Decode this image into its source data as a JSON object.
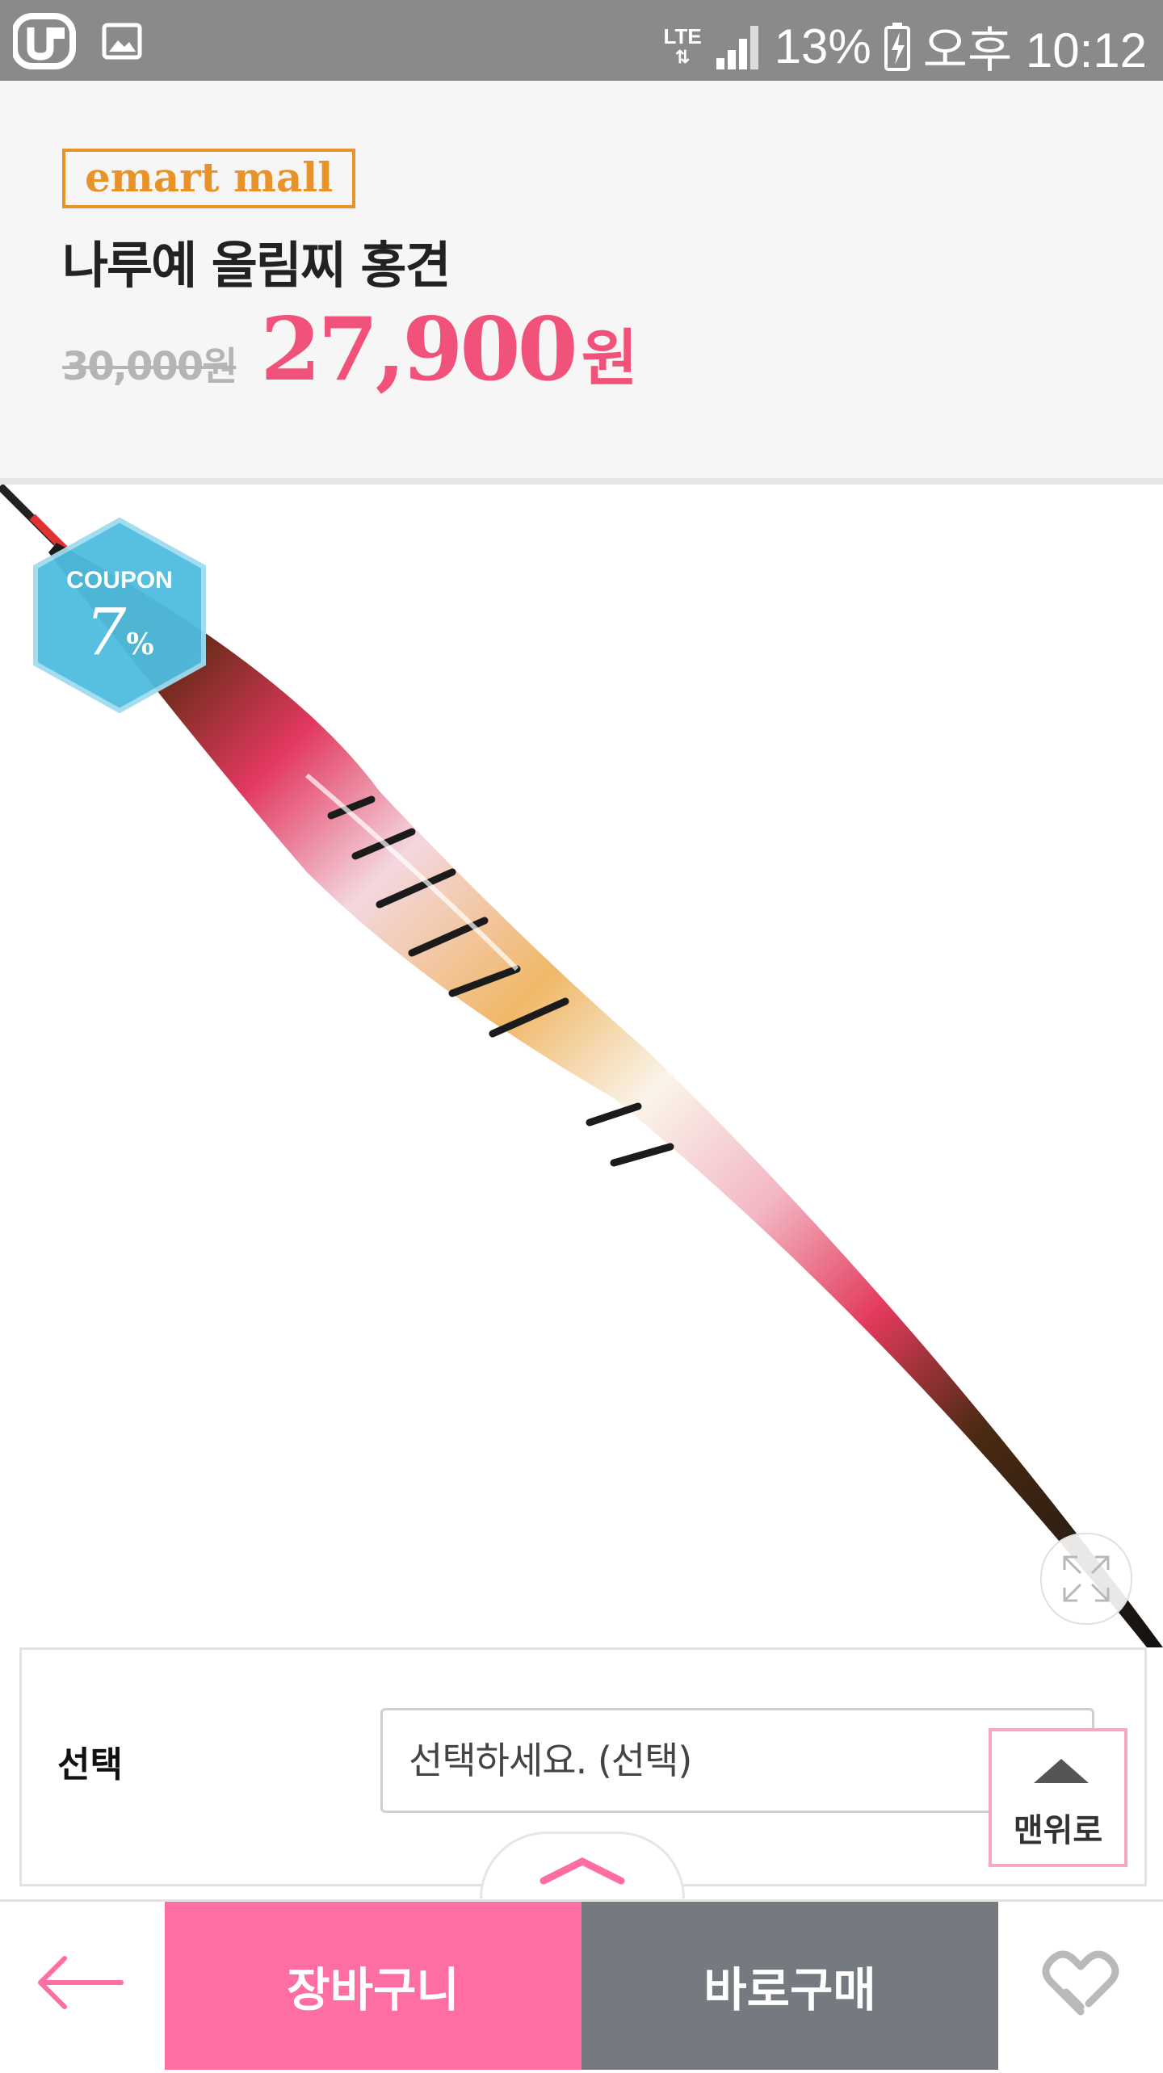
{
  "status_bar": {
    "network": "LTE",
    "battery": "13%",
    "time": "오후 10:12"
  },
  "product": {
    "store": "emart mall",
    "name": "나루예 올림찌 홍견",
    "original_price": "30,000원",
    "sale_price_number": "27,900",
    "sale_price_unit": "원"
  },
  "coupon": {
    "label": "COUPON",
    "value": "7",
    "unit": "%"
  },
  "options": {
    "label": "선택",
    "select_value": "선택하세요. (선택)"
  },
  "scroll_top": {
    "label": "맨위로"
  },
  "bottom_bar": {
    "cart_label": "장바구니",
    "buy_label": "바로구매"
  },
  "colors": {
    "accent_pink": "#ff6ea2",
    "price_pink": "#f0527a",
    "store_orange": "#e8932a",
    "coupon_blue": "#4fbde0",
    "buy_gray": "#757980"
  }
}
